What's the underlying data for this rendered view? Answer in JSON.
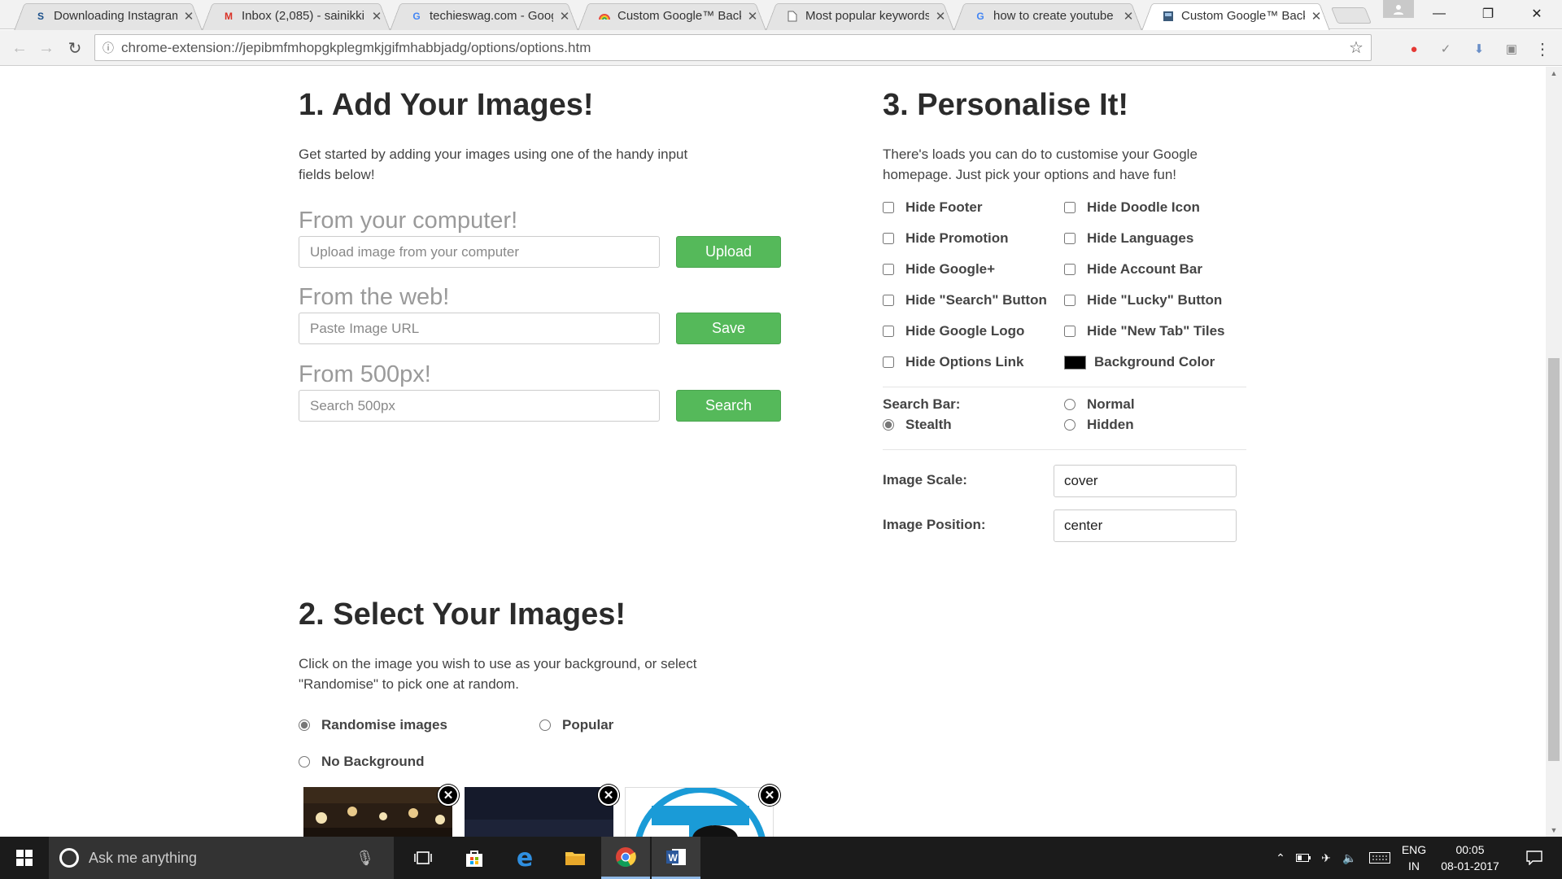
{
  "browser": {
    "tabs": [
      {
        "title": "Downloading Instagram",
        "favicon": "techieswag-s-icon",
        "active": false
      },
      {
        "title": "Inbox (2,085) - sainikki",
        "favicon": "gmail-m-icon",
        "active": false
      },
      {
        "title": "techieswag.com - Goog",
        "favicon": "google-g-icon",
        "active": false
      },
      {
        "title": "Custom Google™ Back",
        "favicon": "rainbow-icon",
        "active": false
      },
      {
        "title": "Most popular keywords",
        "favicon": "page-icon",
        "active": false
      },
      {
        "title": "how to create youtube",
        "favicon": "google-g-icon",
        "active": false
      },
      {
        "title": "Custom Google™ Back",
        "favicon": "extension-icon",
        "active": true
      }
    ],
    "url": "chrome-extension://jepibmfmhopgkplegmkjgifmhabbjadg/options/options.htm"
  },
  "section1": {
    "title": "1. Add Your Images!",
    "description": "Get started by adding your images using one of the handy input fields below!",
    "computer": {
      "label": "From your computer!",
      "placeholder": "Upload image from your computer",
      "button": "Upload"
    },
    "web": {
      "label": "From the web!",
      "placeholder": "Paste Image URL",
      "button": "Save"
    },
    "px500": {
      "label": "From 500px!",
      "placeholder": "Search 500px",
      "button": "Search"
    }
  },
  "section2": {
    "title": "2. Select Your Images!",
    "description": "Click on the image you wish to use as your background, or select \"Randomise\" to pick one at random.",
    "options": {
      "randomise": "Randomise images",
      "popular": "Popular",
      "no_background": "No Background"
    },
    "selected": "randomise",
    "thumbnails": [
      "chandelier-hall-image",
      "night-sky-image",
      "blue-t-logo-image"
    ]
  },
  "section3": {
    "title": "3. Personalise It!",
    "description": "There's loads you can do to customise your Google homepage. Just pick your options and have fun!",
    "checkboxes": {
      "hide_footer": "Hide Footer",
      "hide_doodle_icon": "Hide Doodle Icon",
      "hide_promotion": "Hide Promotion",
      "hide_languages": "Hide Languages",
      "hide_google_plus": "Hide Google+",
      "hide_account_bar": "Hide Account Bar",
      "hide_search_button": "Hide \"Search\" Button",
      "hide_lucky_button": "Hide \"Lucky\" Button",
      "hide_google_logo": "Hide Google Logo",
      "hide_new_tab_tiles": "Hide \"New Tab\" Tiles",
      "hide_options_link": "Hide Options Link"
    },
    "background_color": {
      "label": "Background Color",
      "value": "#000000"
    },
    "search_bar": {
      "label": "Search Bar:",
      "normal": "Normal",
      "stealth": "Stealth",
      "hidden": "Hidden",
      "selected": "stealth"
    },
    "image_scale": {
      "label": "Image Scale:",
      "value": "cover"
    },
    "image_position": {
      "label": "Image Position:",
      "value": "center"
    }
  },
  "taskbar": {
    "search_placeholder": "Ask me anything",
    "language": "ENG",
    "region": "IN",
    "time": "00:05",
    "date": "08-01-2017"
  },
  "colors": {
    "button_green": "#55b95a",
    "taskbar": "#1b1b1b"
  }
}
